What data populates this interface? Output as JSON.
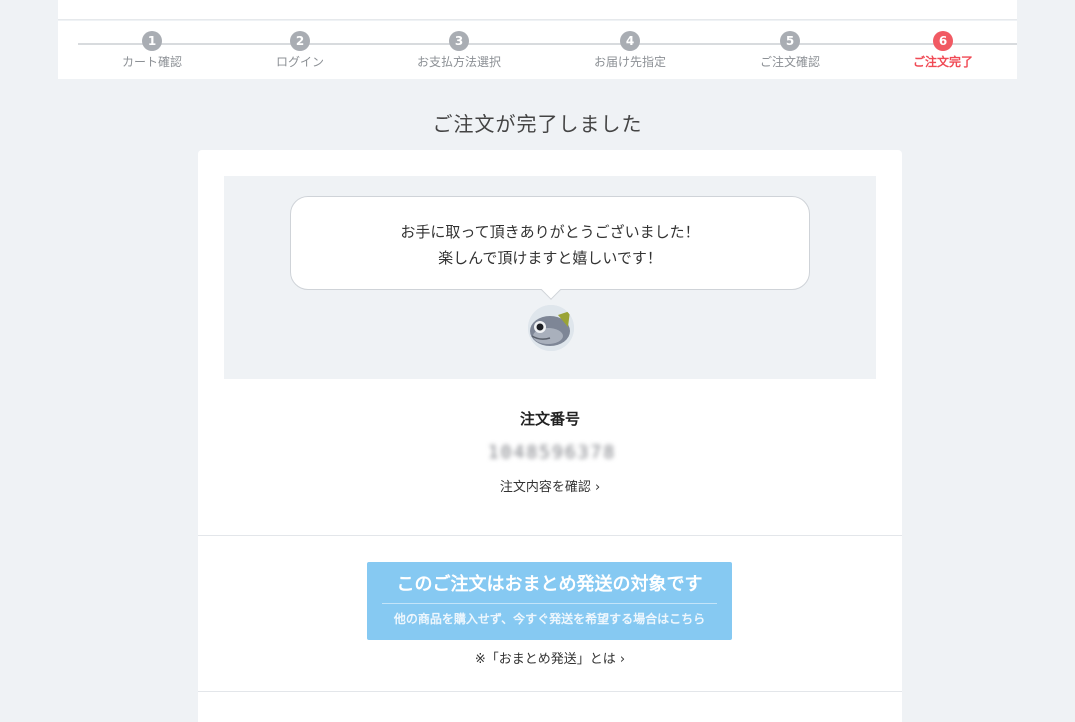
{
  "stepper": {
    "steps": [
      {
        "num": "1",
        "label": "カート確認"
      },
      {
        "num": "2",
        "label": "ログイン"
      },
      {
        "num": "3",
        "label": "お支払方法選択"
      },
      {
        "num": "4",
        "label": "お届け先指定"
      },
      {
        "num": "5",
        "label": "ご注文確認"
      },
      {
        "num": "6",
        "label": "ご注文完了"
      }
    ],
    "active_index": 5,
    "active_color": "#f15a63"
  },
  "page": {
    "title": "ご注文が完了しました"
  },
  "message": {
    "line1": "お手に取って頂きありがとうございました！",
    "line2": "楽しんで頂けますと嬉しいです！",
    "avatar_icon": "fish-avatar-icon"
  },
  "order": {
    "label": "注文番号",
    "number": "1048596378",
    "detail_link": "注文内容を確認 ›"
  },
  "bundle": {
    "title": "このご注文はおまとめ発送の対象です",
    "subtitle": "他の商品を購入せず、今すぐ発送を希望する場合はこちら",
    "note_link": "※「おまとめ発送」とは ›",
    "button_color": "#86c9f2"
  }
}
